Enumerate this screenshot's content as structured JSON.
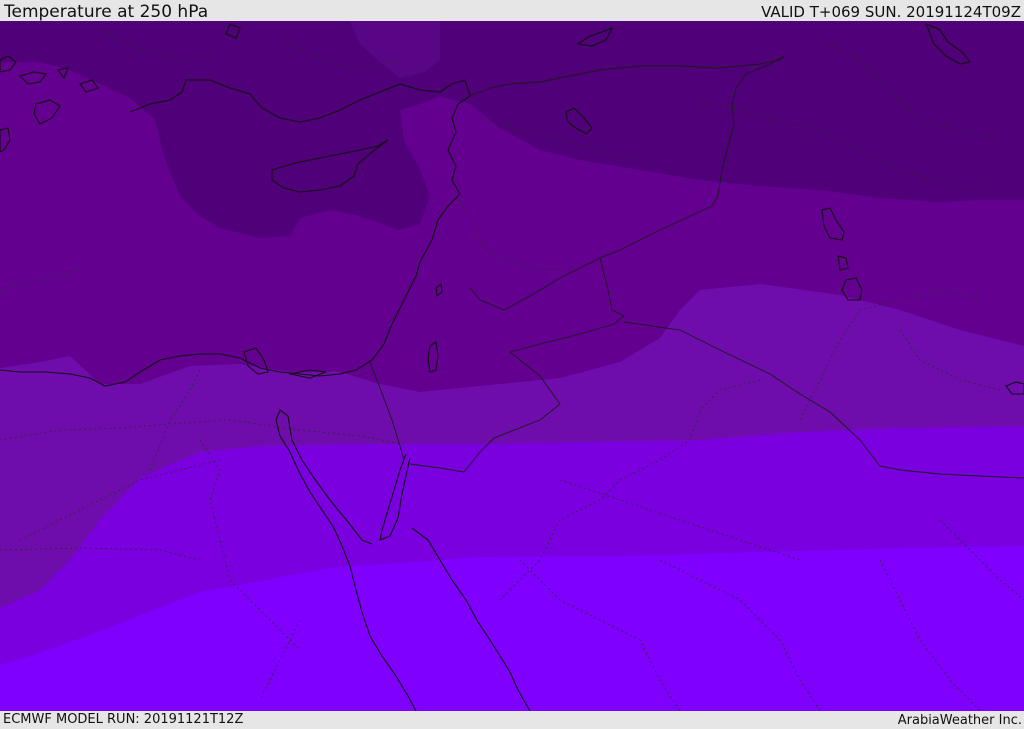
{
  "header": {
    "title": "Temperature at 250 hPa",
    "valid_time": "VALID T+069 SUN. 20191124T09Z"
  },
  "footer": {
    "model_run": "ECMWF MODEL RUN: 20191121T12Z",
    "credit": "ArabiaWeather Inc."
  },
  "map": {
    "field": "temperature-250hPa",
    "bands": [
      {
        "name": "coldest",
        "color": "#500078"
      },
      {
        "name": "cold",
        "color": "#630090"
      },
      {
        "name": "mid",
        "color": "#6f0dac"
      },
      {
        "name": "warm",
        "color": "#7a00e0"
      },
      {
        "name": "warmest",
        "color": "#7f00ff"
      }
    ],
    "coastline_color": "#111111",
    "border_color": "#2a2a2a"
  }
}
